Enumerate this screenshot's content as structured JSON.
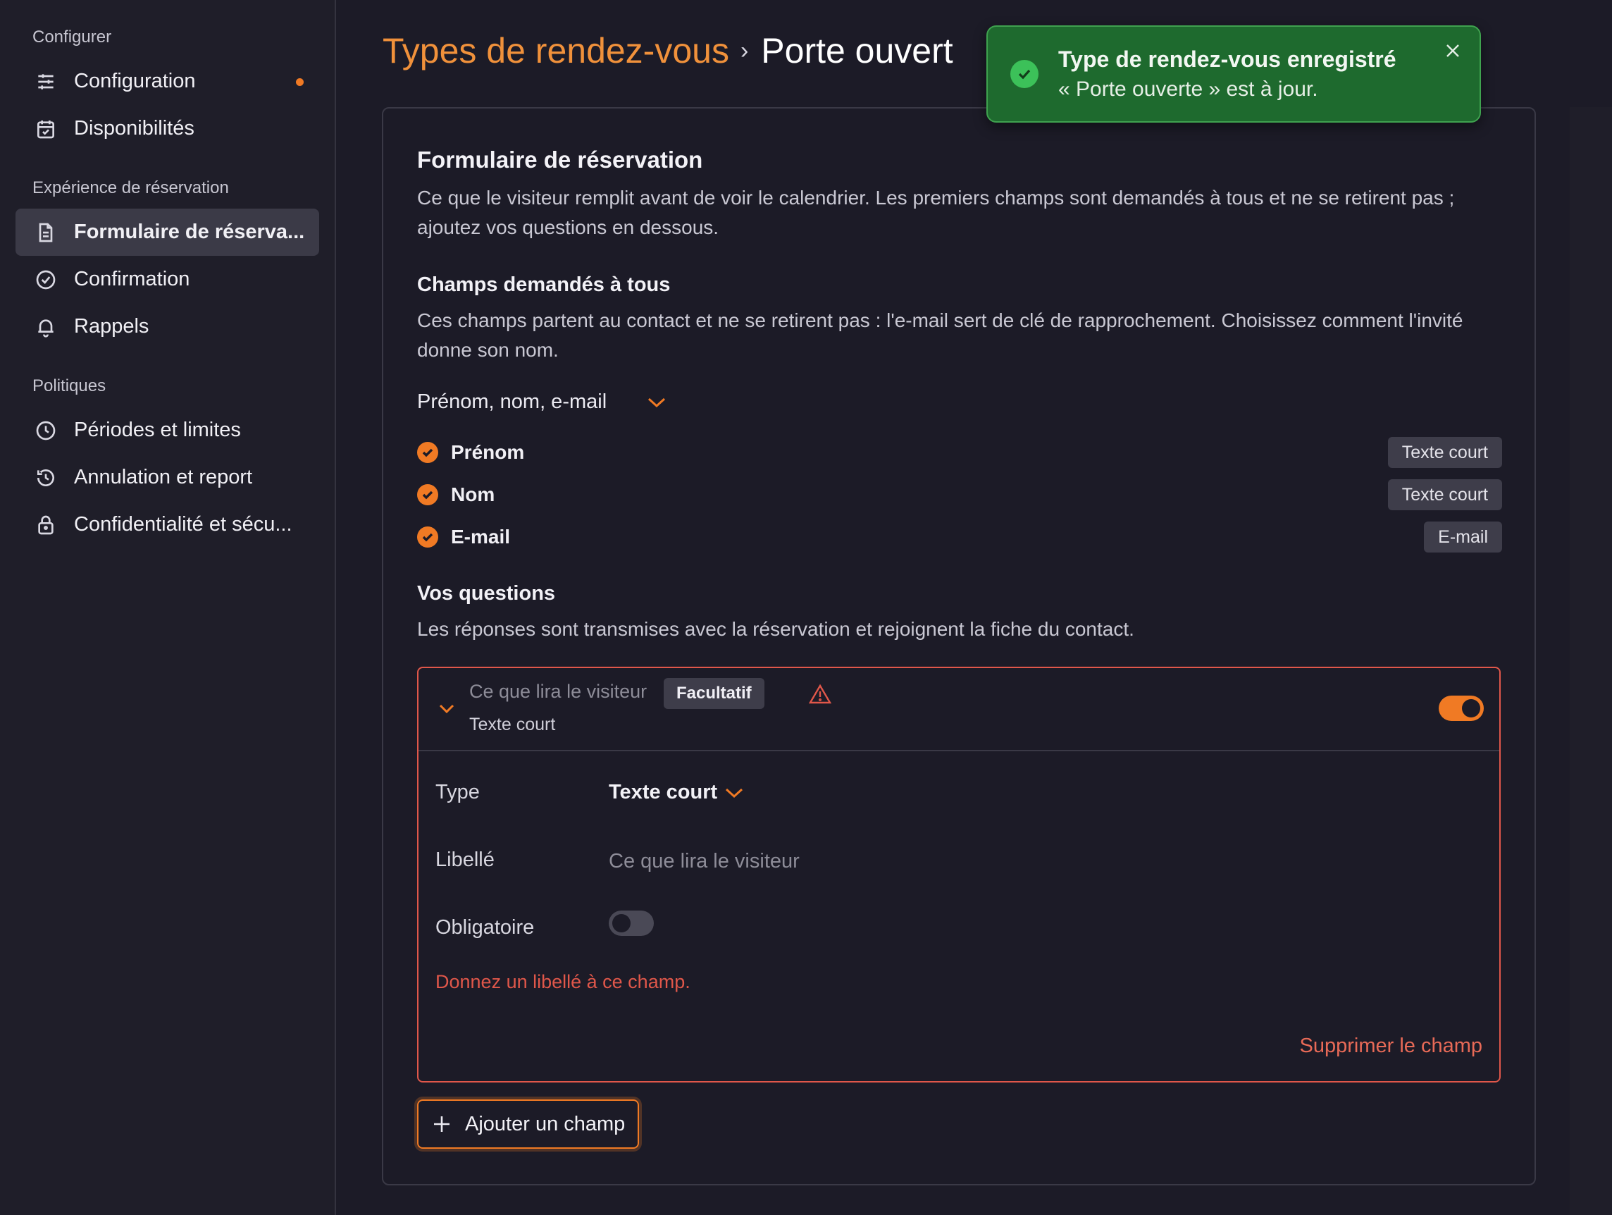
{
  "sidebar": {
    "sections": [
      {
        "label": "Configurer",
        "items": [
          {
            "label": "Configuration",
            "icon": "sliders-icon",
            "dot": true
          },
          {
            "label": "Disponibilités",
            "icon": "calendar-check-icon"
          }
        ]
      },
      {
        "label": "Expérience de réservation",
        "items": [
          {
            "label": "Formulaire de réserva...",
            "icon": "document-icon",
            "active": true
          },
          {
            "label": "Confirmation",
            "icon": "check-circle-icon"
          },
          {
            "label": "Rappels",
            "icon": "bell-icon"
          }
        ]
      },
      {
        "label": "Politiques",
        "items": [
          {
            "label": "Périodes et limites",
            "icon": "clock-icon"
          },
          {
            "label": "Annulation et report",
            "icon": "history-icon"
          },
          {
            "label": "Confidentialité et sécu...",
            "icon": "lock-icon"
          }
        ]
      }
    ]
  },
  "breadcrumb": {
    "parent": "Types de rendez-vous",
    "separator": "›",
    "current": "Porte ouvert"
  },
  "toast": {
    "title": "Type de rendez-vous enregistré",
    "message": "« Porte ouverte » est à jour.",
    "icon": "check-circle-icon",
    "close_icon": "close-icon"
  },
  "form": {
    "title": "Formulaire de réservation",
    "description": "Ce que le visiteur remplit avant de voir le calendrier. Les premiers champs sont demandés à tous et ne se retirent pas ; ajoutez vos questions en dessous.",
    "required_fields": {
      "title": "Champs demandés à tous",
      "description": "Ces champs partent au contact et ne se retirent pas : l'e-mail sert de clé de rapprochement. Choisissez comment l'invité donne son nom.",
      "name_mode": "Prénom, nom, e-mail",
      "fields": [
        {
          "label": "Prénom",
          "type": "Texte court"
        },
        {
          "label": "Nom",
          "type": "Texte court"
        },
        {
          "label": "E-mail",
          "type": "E-mail"
        }
      ]
    },
    "questions": {
      "title": "Vos questions",
      "description": "Les réponses sont transmises avec la réservation et rejoignent la fiche du contact.",
      "item": {
        "label_placeholder": "Ce que lira le visiteur",
        "badge": "Facultatif",
        "type_summary": "Texte court",
        "enabled": true,
        "type_label": "Type",
        "type_value": "Texte court",
        "libelle_label": "Libellé",
        "libelle_value": "",
        "libelle_placeholder": "Ce que lira le visiteur",
        "required_label": "Obligatoire",
        "required": false,
        "error": "Donnez un libellé à ce champ.",
        "delete_label": "Supprimer le champ"
      },
      "add_label": "Ajouter un champ"
    }
  },
  "colors": {
    "accent": "#f07a24",
    "error": "#e0574a",
    "success": "#1e6a2e"
  }
}
